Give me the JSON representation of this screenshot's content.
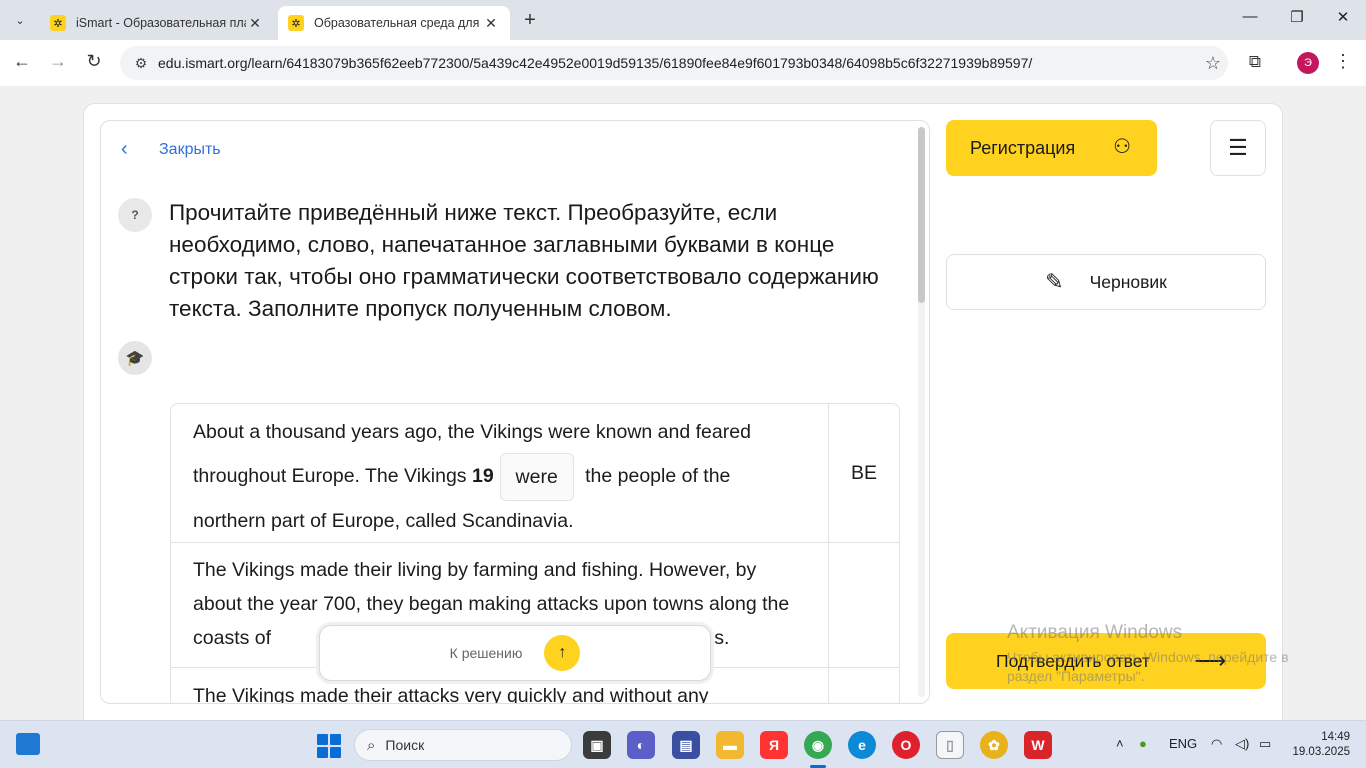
{
  "browser": {
    "tabs": [
      {
        "title": "iSmart - Образовательная пла",
        "active": false
      },
      {
        "title": "Образовательная среда для с",
        "active": true
      }
    ],
    "url": "edu.ismart.org/learn/64183079b365f62eeb772300/5a439c42e4952e0019d59135/61890fee84e9f601793b0348/64098b5c6f32271939b89597/",
    "avatar_letter": "Э"
  },
  "task": {
    "close_label": "Закрыть",
    "question_badge": "?",
    "question": "Прочитайте приведённый ниже текст. Преобразуйте, если необходимо, слово, напечатанное заглавными буквами в конце строки так, чтобы оно грамматически соответствовало содержанию текста. Заполните пропуск полученным словом.",
    "rows": [
      {
        "text_before": "About a thousand years ago, the Vikings were known and feared throughout Europe. The Vikings ",
        "gap_number": "19",
        "answer": "were",
        "text_after": " the people of the northern part of Europe, called Scandinavia.",
        "word": "BE"
      },
      {
        "text_before": "The Vikings made their living by farming and fishing. However, by about the year 700, they began making attacks upon towns along the coasts of",
        "text_tail": "towns.",
        "word": ""
      },
      {
        "text_before": "The Vikings made their attacks very quickly and without any",
        "word": ""
      }
    ],
    "to_solution_label": "К решению"
  },
  "sidebar": {
    "register_label": "Регистрация",
    "draft_label": "Черновик",
    "confirm_label": "Подтвердить ответ"
  },
  "watermark": {
    "title": "Активация Windows",
    "text": "Чтобы активировать Windows, перейдите в раздел \"Параметры\"."
  },
  "taskbar": {
    "search_placeholder": "Поиск",
    "lang": "ENG",
    "time": "14:49",
    "date": "19.03.2025"
  },
  "colors": {
    "accent_yellow": "#ffd21f",
    "link_blue": "#2f6fde"
  }
}
